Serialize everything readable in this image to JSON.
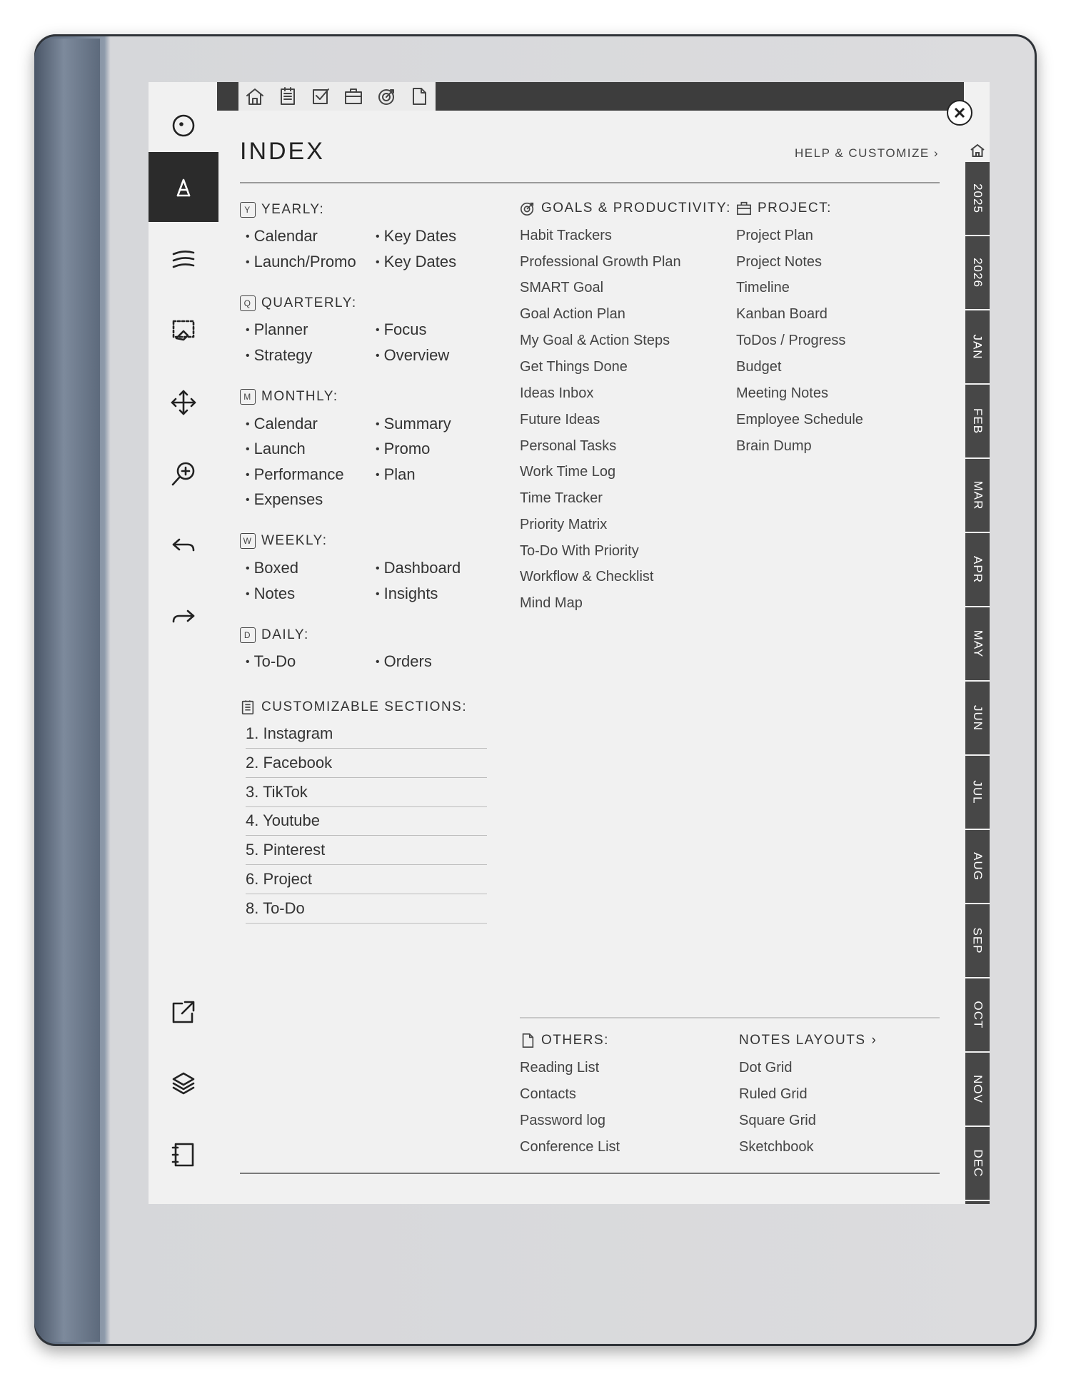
{
  "top_tabs": [
    "home-icon",
    "notes-icon",
    "checkbox-icon",
    "briefcase-icon",
    "goal-icon",
    "page-icon"
  ],
  "title": "INDEX",
  "help_link": "HELP & CUSTOMIZE",
  "yearly": {
    "heading": "YEARLY:",
    "badge": "Y",
    "col1": [
      "Calendar",
      "Launch/Promo"
    ],
    "col2": [
      "Key Dates",
      "Key Dates"
    ]
  },
  "quarterly": {
    "heading": "QUARTERLY:",
    "badge": "Q",
    "col1": [
      "Planner",
      "Strategy"
    ],
    "col2": [
      "Focus",
      "Overview"
    ]
  },
  "monthly": {
    "heading": "MONTHLY:",
    "badge": "M",
    "col1": [
      "Calendar",
      "Launch",
      "Performance",
      "Expenses"
    ],
    "col2": [
      "Summary",
      "Promo",
      "Plan"
    ]
  },
  "weekly": {
    "heading": "WEEKLY:",
    "badge": "W",
    "col1": [
      "Boxed",
      "Notes"
    ],
    "col2": [
      "Dashboard",
      "Insights"
    ]
  },
  "daily": {
    "heading": "DAILY:",
    "badge": "D",
    "col1": [
      "To-Do"
    ],
    "col2": [
      "Orders"
    ]
  },
  "customizable": {
    "heading": "CUSTOMIZABLE SECTIONS:",
    "items": [
      "1. Instagram",
      "2. Facebook",
      "3. TikTok",
      "4. Youtube",
      "5. Pinterest",
      "6. Project",
      "8. To-Do"
    ]
  },
  "goals": {
    "heading": "GOALS & PRODUCTIVITY:",
    "items": [
      "Habit Trackers",
      "Professional Growth Plan",
      "SMART Goal",
      "Goal Action Plan",
      "My Goal & Action Steps",
      "Get Things Done",
      "Ideas Inbox",
      "Future Ideas",
      "Personal Tasks",
      "Work Time Log",
      "Time Tracker",
      "Priority Matrix",
      "To-Do With Priority",
      "Workflow & Checklist",
      "Mind Map"
    ]
  },
  "project": {
    "heading": "PROJECT:",
    "items": [
      "Project Plan",
      "Project Notes",
      "Timeline",
      "Kanban Board",
      "ToDos / Progress",
      "Budget",
      "Meeting Notes",
      "Employee Schedule",
      "Brain Dump"
    ]
  },
  "others": {
    "heading": "OTHERS:",
    "items": [
      "Reading List",
      "Contacts",
      "Password log",
      "Conference List"
    ]
  },
  "notes_layouts": {
    "heading": "NOTES LAYOUTS",
    "items": [
      "Dot Grid",
      "Ruled Grid",
      "Square Grid",
      "Sketchbook"
    ]
  },
  "side_tabs": [
    "2025",
    "2026",
    "JAN",
    "FEB",
    "MAR",
    "APR",
    "MAY",
    "JUN",
    "JUL",
    "AUG",
    "SEP",
    "OCT",
    "NOV",
    "DEC"
  ],
  "colors": {
    "dark_bar": "#3d3d3d",
    "tab_strip": "#474747",
    "paper": "#f1f1f1"
  }
}
